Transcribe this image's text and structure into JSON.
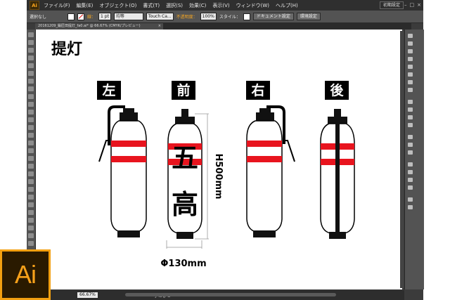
{
  "menubar": {
    "app_icon": "Ai",
    "items": [
      "ファイル(F)",
      "編集(E)",
      "オブジェクト(O)",
      "書式(T)",
      "選択(S)",
      "効果(C)",
      "表示(V)",
      "ウィンドウ(W)",
      "ヘルプ(H)"
    ],
    "workspace": "初期設定",
    "window_controls": [
      "–",
      "□",
      "×"
    ]
  },
  "control_bar": {
    "selection_label": "選択なし",
    "stroke_label": "線：",
    "stroke_weight": "1 pt",
    "stroke_style": "均等",
    "brush": "Touch Ca...",
    "opacity_label": "不透明度：",
    "opacity_value": "100%",
    "style_label": "スタイル：",
    "document_setup": "ドキュメント設定",
    "preferences": "環境設定"
  },
  "document_tab": {
    "title": "20161209_鍛匠田提灯_fa0.ai* @ 66.67% (CMYK/プレビュー)",
    "close": "×"
  },
  "artwork": {
    "title": "提灯",
    "views": [
      "左",
      "前",
      "右",
      "後"
    ],
    "front_characters": [
      "五",
      "高"
    ],
    "height_dimension": "H500mm",
    "diameter_dimension": "Φ130mm"
  },
  "statusbar": {
    "zoom": "66.67%",
    "tool": "手のひら"
  },
  "badge": {
    "text": "Ai"
  },
  "colors": {
    "accent_orange": "#f7a11a",
    "stripe_red": "#e8141e",
    "ui_dark": "#3b3b3b"
  }
}
